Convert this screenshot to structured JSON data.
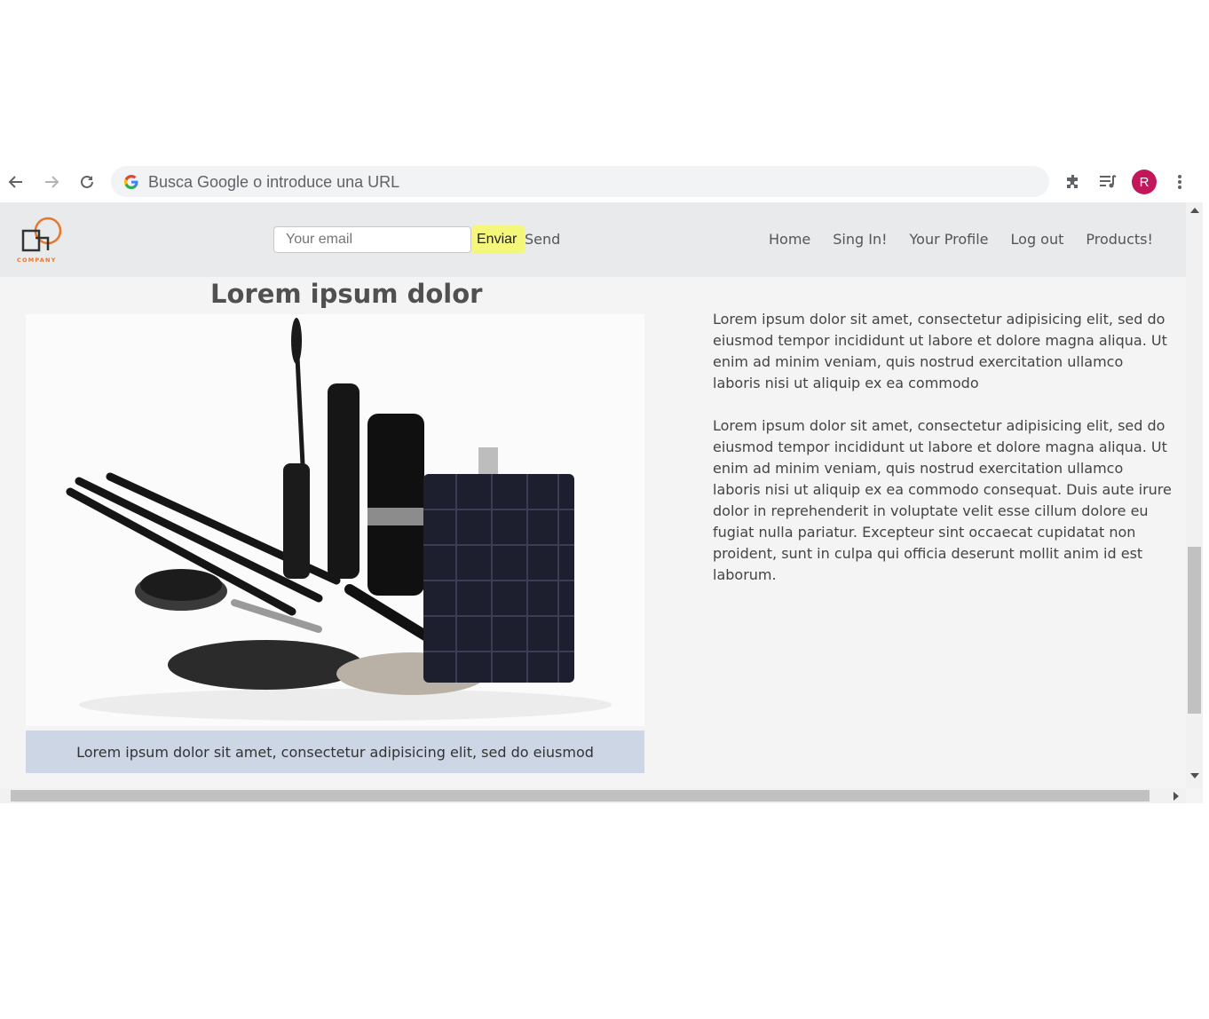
{
  "browser": {
    "omnibox_placeholder": "Busca Google o introduce una URL",
    "avatar_letter": "R"
  },
  "header": {
    "logo_text": "COMPANY",
    "email_placeholder": "Your email",
    "submit_label": "Enviar",
    "send_label": "Send",
    "nav": [
      "Home",
      "Sing In!",
      "Your Profile",
      "Log out",
      "Products!"
    ]
  },
  "main": {
    "heading": "Lorem ipsum dolor",
    "image_caption": "Lorem ipsum dolor sit amet, consectetur adipisicing elit, sed do eiusmod",
    "paragraphs": [
      "Lorem ipsum dolor sit amet, consectetur adipisicing elit, sed do eiusmod tempor incididunt ut labore et dolore magna aliqua. Ut enim ad minim veniam, quis nostrud exercitation ullamco laboris nisi ut aliquip ex ea commodo",
      "Lorem ipsum dolor sit amet, consectetur adipisicing elit, sed do eiusmod tempor incididunt ut labore et dolore magna aliqua. Ut enim ad minim veniam, quis nostrud exercitation ullamco laboris nisi ut aliquip ex ea commodo consequat. Duis aute irure dolor in reprehenderit in voluptate velit esse cillum dolore eu fugiat nulla pariatur. Excepteur sint occaecat cupidatat non proident, sunt in culpa qui officia deserunt mollit anim id est laborum."
    ]
  },
  "colors": {
    "avatar": "#c2185b",
    "submit_button": "#f4f77a",
    "caption_bg": "#cdd6e4",
    "header_bg": "#e9eaec",
    "logo_orange": "#e8762c"
  }
}
